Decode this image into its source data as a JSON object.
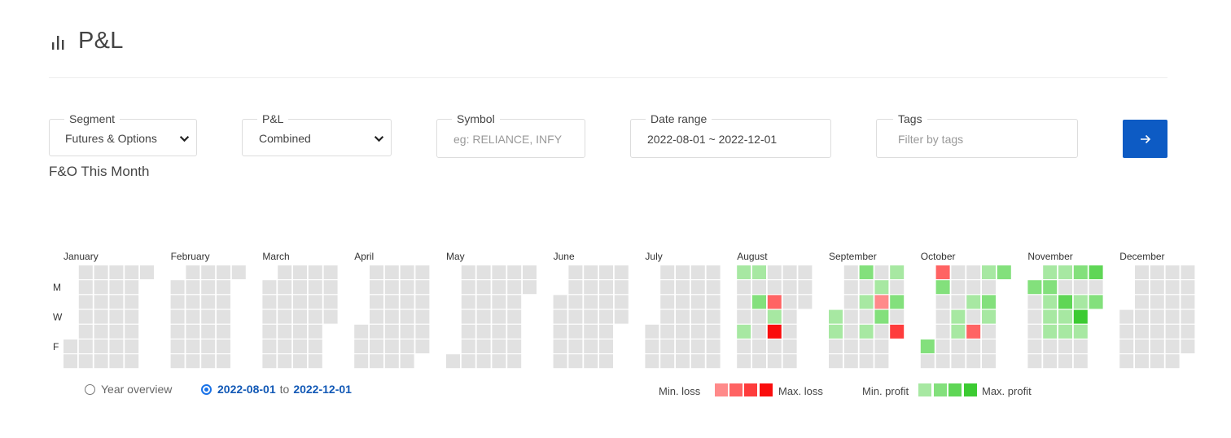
{
  "header": {
    "title": "P&L",
    "icon": "bar-chart-icon"
  },
  "filters": {
    "segment": {
      "label": "Segment",
      "value": "Futures & Options"
    },
    "pnl": {
      "label": "P&L",
      "value": "Combined"
    },
    "symbol": {
      "label": "Symbol",
      "placeholder": "eg: RELIANCE, INFY"
    },
    "date_range": {
      "label": "Date range",
      "value": "2022-08-01 ~ 2022-12-01"
    },
    "tags": {
      "label": "Tags",
      "placeholder": "Filter by tags"
    },
    "go_icon": "arrow-right-icon"
  },
  "section_title": "F&O This Month",
  "calendar": {
    "weekday_labels": [
      {
        "row": 1,
        "label": "M"
      },
      {
        "row": 3,
        "label": "W"
      },
      {
        "row": 5,
        "label": "F"
      }
    ],
    "months": [
      "January",
      "February",
      "March",
      "April",
      "May",
      "June",
      "July",
      "August",
      "September",
      "October",
      "November",
      "December"
    ],
    "empty_color": "#e1e1e1",
    "levels": {
      "p1": "#a7e8a2",
      "p2": "#83e07c",
      "p3": "#5fd656",
      "p4": "#3ccb32",
      "l1": "#ff8a8a",
      "l2": "#ff6363",
      "l3": "#fe3c3c",
      "l4": "#fa0d0d"
    },
    "marked_days": [
      {
        "date": "2022-08-01",
        "level": "p1"
      },
      {
        "date": "2022-08-05",
        "level": "p1"
      },
      {
        "date": "2022-08-10",
        "level": "p2"
      },
      {
        "date": "2022-08-08",
        "level": "p1"
      },
      {
        "date": "2022-08-17",
        "level": "l2"
      },
      {
        "date": "2022-08-18",
        "level": "p1"
      },
      {
        "date": "2022-08-19",
        "level": "l4"
      },
      {
        "date": "2022-09-01",
        "level": "p1"
      },
      {
        "date": "2022-09-02",
        "level": "p1"
      },
      {
        "date": "2022-09-12",
        "level": "p2"
      },
      {
        "date": "2022-09-14",
        "level": "p1"
      },
      {
        "date": "2022-09-16",
        "level": "p1"
      },
      {
        "date": "2022-09-20",
        "level": "p1"
      },
      {
        "date": "2022-09-21",
        "level": "l1"
      },
      {
        "date": "2022-09-22",
        "level": "p2"
      },
      {
        "date": "2022-09-26",
        "level": "p1"
      },
      {
        "date": "2022-09-28",
        "level": "p2"
      },
      {
        "date": "2022-09-30",
        "level": "l3"
      },
      {
        "date": "2022-10-03",
        "level": "l2"
      },
      {
        "date": "2022-10-01",
        "level": "p2"
      },
      {
        "date": "2022-10-04",
        "level": "p2"
      },
      {
        "date": "2022-10-13",
        "level": "p1"
      },
      {
        "date": "2022-10-14",
        "level": "p1"
      },
      {
        "date": "2022-10-19",
        "level": "p1"
      },
      {
        "date": "2022-10-21",
        "level": "l2"
      },
      {
        "date": "2022-10-24",
        "level": "p1"
      },
      {
        "date": "2022-10-26",
        "level": "p2"
      },
      {
        "date": "2022-10-27",
        "level": "p1"
      },
      {
        "date": "2022-10-31",
        "level": "p2"
      },
      {
        "date": "2022-11-01",
        "level": "p2"
      },
      {
        "date": "2022-11-07",
        "level": "p1"
      },
      {
        "date": "2022-11-08",
        "level": "p2"
      },
      {
        "date": "2022-11-09",
        "level": "p1"
      },
      {
        "date": "2022-11-10",
        "level": "p1"
      },
      {
        "date": "2022-11-11",
        "level": "p1"
      },
      {
        "date": "2022-11-14",
        "level": "p1"
      },
      {
        "date": "2022-11-16",
        "level": "p3"
      },
      {
        "date": "2022-11-17",
        "level": "p1"
      },
      {
        "date": "2022-11-18",
        "level": "p1"
      },
      {
        "date": "2022-11-21",
        "level": "p2"
      },
      {
        "date": "2022-11-23",
        "level": "p1"
      },
      {
        "date": "2022-11-24",
        "level": "p4"
      },
      {
        "date": "2022-11-25",
        "level": "p1"
      },
      {
        "date": "2022-11-28",
        "level": "p3"
      },
      {
        "date": "2022-11-30",
        "level": "p2"
      }
    ]
  },
  "view_options": {
    "year_overview": "Year overview",
    "range_from": "2022-08-01",
    "range_to_word": "to",
    "range_to": "2022-12-01"
  },
  "legend": {
    "min_loss": "Min. loss",
    "max_loss": "Max. loss",
    "min_profit": "Min. profit",
    "max_profit": "Max. profit",
    "loss_colors": [
      "#ff8a8a",
      "#ff6363",
      "#fe3c3c",
      "#fa0d0d"
    ],
    "profit_colors": [
      "#a7e8a2",
      "#83e07c",
      "#5fd656",
      "#3ccb32"
    ]
  }
}
